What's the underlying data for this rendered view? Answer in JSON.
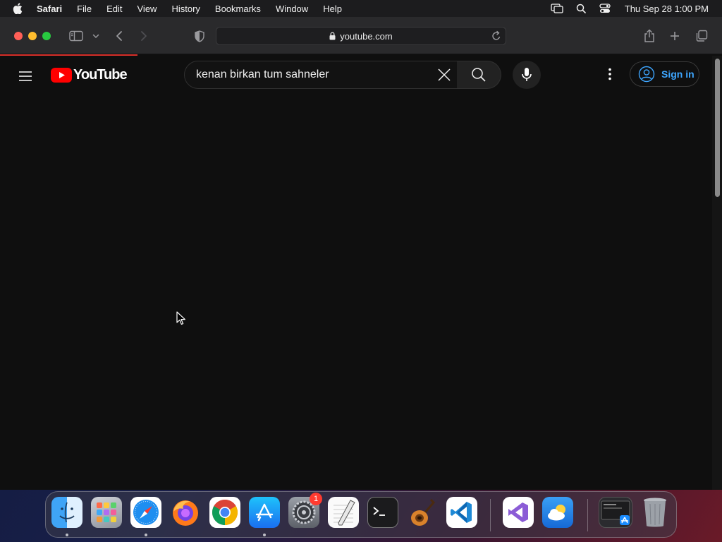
{
  "menubar": {
    "app_name": "Safari",
    "items": [
      "File",
      "Edit",
      "View",
      "History",
      "Bookmarks",
      "Window",
      "Help"
    ],
    "clock": "Thu Sep 28  1:00 PM",
    "status_icons": [
      "screen-mirroring-icon",
      "spotlight-search-icon",
      "control-center-icon"
    ]
  },
  "safari": {
    "address": "youtube.com",
    "toolbar_icons": [
      "sidebar-icon",
      "chevron-down-icon",
      "back-icon",
      "forward-icon",
      "privacy-shield-icon",
      "share-icon",
      "new-tab-icon",
      "tab-overview-icon"
    ]
  },
  "youtube": {
    "logo_text": "YouTube",
    "search": {
      "value": "kenan birkan tum sahneler",
      "placeholder": "Search"
    },
    "signin_label": "Sign in"
  },
  "dock": {
    "apps": [
      "Finder",
      "Launchpad",
      "Safari",
      "Firefox",
      "Chrome",
      "App Store",
      "System Settings",
      "TextEdit",
      "Terminal",
      "GarageBand",
      "Visual Studio Code",
      "Visual Studio",
      "Weather",
      "Downloads",
      "Trash"
    ],
    "system_settings_badge": "1"
  },
  "colors": {
    "accent_blue": "#3ea6ff",
    "youtube_red": "#ff0000",
    "page_bg": "#0f0f0f"
  }
}
